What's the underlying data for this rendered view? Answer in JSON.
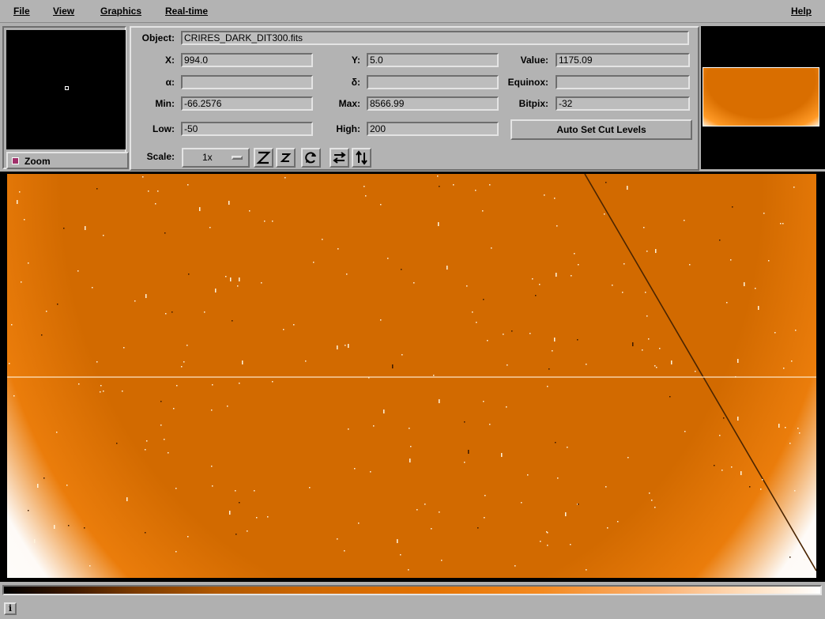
{
  "menu": {
    "file": "File",
    "view": "View",
    "graphics": "Graphics",
    "realtime": "Real-time",
    "help": "Help"
  },
  "zoom": {
    "label": "Zoom",
    "enabled": true
  },
  "info": {
    "object_label": "Object:",
    "object_value": "CRIRES_DARK_DIT300.fits",
    "x_label": "X:",
    "x_value": "994.0",
    "y_label": "Y:",
    "y_value": "5.0",
    "value_label": "Value:",
    "value_value": "1175.09",
    "ra_label": "α:",
    "ra_value": "",
    "dec_label": "δ:",
    "dec_value": "",
    "equinox_label": "Equinox:",
    "equinox_value": "",
    "min_label": "Min:",
    "min_value": "-66.2576",
    "max_label": "Max:",
    "max_value": "8566.99",
    "bitpix_label": "Bitpix:",
    "bitpix_value": "-32",
    "low_label": "Low:",
    "low_value": "-50",
    "high_label": "High:",
    "high_value": "200",
    "autocut_label": "Auto Set Cut Levels",
    "scale_label": "Scale:",
    "scale_value": "1x"
  },
  "toolbar_icons": [
    "zoom-in-icon",
    "zoom-out-icon",
    "rotate-icon",
    "flip-x-icon",
    "flip-y-icon"
  ],
  "colors": {
    "image_base": "#d26a00",
    "image_bright": "#ffffff",
    "colormap": "orange-heat"
  },
  "status": {
    "icon": "info-icon",
    "icon_glyph": "i",
    "text": ""
  }
}
